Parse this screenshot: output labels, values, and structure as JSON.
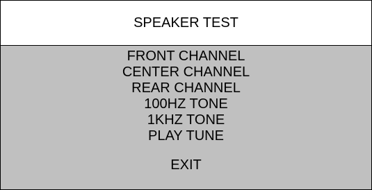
{
  "title": "SPEAKER TEST",
  "menu": {
    "items": [
      {
        "label": "FRONT CHANNEL"
      },
      {
        "label": "CENTER CHANNEL"
      },
      {
        "label": "REAR CHANNEL"
      },
      {
        "label": "100HZ TONE"
      },
      {
        "label": "1KHZ TONE"
      },
      {
        "label": "PLAY TUNE"
      }
    ],
    "exit_label": "EXIT"
  },
  "colors": {
    "title_background": "#ffffff",
    "menu_background": "#c0c0c0",
    "border": "#000000",
    "text": "#000000"
  }
}
